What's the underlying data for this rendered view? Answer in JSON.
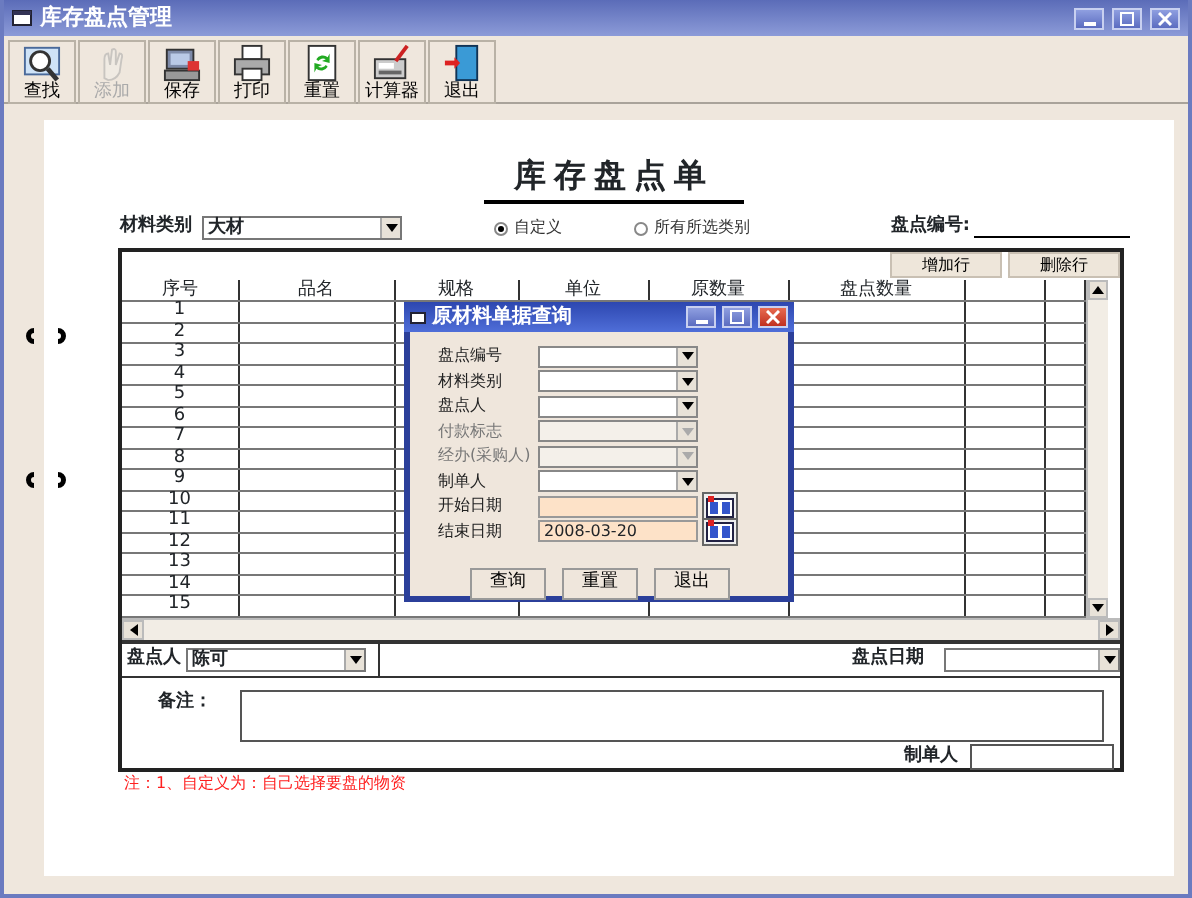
{
  "window": {
    "title": "库存盘点管理"
  },
  "toolbar": [
    {
      "label": "查找",
      "disabled": false
    },
    {
      "label": "添加",
      "disabled": true
    },
    {
      "label": "保存",
      "disabled": false
    },
    {
      "label": "打印",
      "disabled": false
    },
    {
      "label": "重置",
      "disabled": false
    },
    {
      "label": "计算器",
      "disabled": false
    },
    {
      "label": "退出",
      "disabled": false
    }
  ],
  "form": {
    "title": "库存盘点单",
    "category_label": "材料类别",
    "category_value": "大材",
    "scope_options": [
      {
        "label": "自定义",
        "selected": true
      },
      {
        "label": "所有所选类别",
        "selected": false
      }
    ],
    "number_label": "盘点编号:"
  },
  "table": {
    "buttons": [
      "增加行",
      "删除行"
    ],
    "columns": [
      "序号",
      "品名",
      "规格",
      "单位",
      "原数量",
      "盘点数量"
    ],
    "rows": [
      "1",
      "2",
      "3",
      "4",
      "5",
      "6",
      "7",
      "8",
      "9",
      "10",
      "11",
      "12",
      "13",
      "14",
      "15"
    ]
  },
  "footer": {
    "counter_label": "盘点人",
    "counter_value": "陈可",
    "date_label": "盘点日期",
    "remarks_label": "备注：",
    "maker_label": "制单人",
    "note": "注：1、自定义为：自己选择要盘的物资"
  },
  "dialog": {
    "title": "原材料单据查询",
    "fields": [
      {
        "label": "盘点编号",
        "kind": "select",
        "disabled": false
      },
      {
        "label": "材料类别",
        "kind": "select",
        "disabled": false
      },
      {
        "label": "盘点人",
        "kind": "select",
        "disabled": false
      },
      {
        "label": "付款标志",
        "kind": "select",
        "disabled": true
      },
      {
        "label": "经办(采购人)",
        "kind": "select",
        "disabled": true
      },
      {
        "label": "制单人",
        "kind": "select",
        "disabled": false
      },
      {
        "label": "开始日期",
        "kind": "date"
      },
      {
        "label": "结束日期",
        "kind": "date",
        "value": "2008-03-20"
      }
    ],
    "buttons": [
      "查询",
      "重置",
      "退出"
    ]
  }
}
